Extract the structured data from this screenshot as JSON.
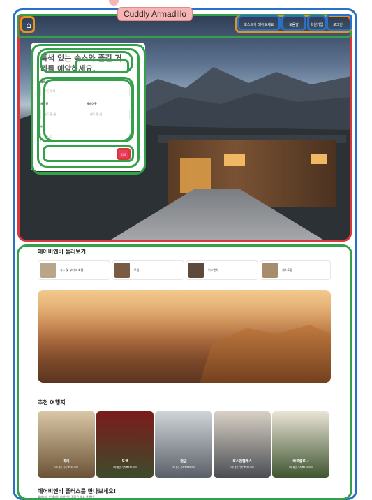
{
  "overlay": {
    "name_tag": "Cuddly Armadillo"
  },
  "nav": {
    "logo_icon": "airbnb-logo-icon",
    "host_label": "호스트가 되어보세요",
    "help_label": "도움말",
    "signup_label": "회원가입",
    "login_label": "로그인"
  },
  "search_card": {
    "title": "특색 있는 숙소와 즐길 거리를 예약하세요.",
    "location_label": "목적지",
    "location_placeholder": "모든 위치",
    "checkin_label": "체크인",
    "checkin_placeholder": "연도-월-일",
    "checkout_label": "체크아웃",
    "checkout_placeholder": "연도-월-일",
    "guests_label": "인원",
    "guests_placeholder": "게스트",
    "search_button": "검색"
  },
  "explore": {
    "title": "에어비앤비 둘러보기",
    "categories": [
      {
        "label": "숙소 및 부티크 호텔",
        "color": "#b8a58a"
      },
      {
        "label": "트립",
        "color": "#7a5c45"
      },
      {
        "label": "어드벤처",
        "color": "#5d4a3c"
      },
      {
        "label": "레스토랑",
        "color": "#a88d6c"
      }
    ]
  },
  "recommended": {
    "title": "추천 여행지",
    "destinations": [
      {
        "name": "파리",
        "sub": "1박 평균 가격 ₩120,000",
        "color_top": "#d9c7a6",
        "color_bottom": "#6b5236"
      },
      {
        "name": "도쿄",
        "sub": "1박 평균 가격 ₩150,000",
        "color_top": "#7b1c1c",
        "color_bottom": "#3d4b2c"
      },
      {
        "name": "런던",
        "sub": "1박 평균 가격 ₩180,000",
        "color_top": "#cfd4d8",
        "color_bottom": "#5b6068"
      },
      {
        "name": "로스앤젤레스",
        "sub": "1박 평균 가격 ₩160,000",
        "color_top": "#d8d0c5",
        "color_bottom": "#4a4e53"
      },
      {
        "name": "바르셀로나",
        "sub": "1박 평균 가격 ₩110,000",
        "color_top": "#e9e4d6",
        "color_bottom": "#3f5530"
      }
    ]
  },
  "plus": {
    "title": "에어비앤비 플러스를 만나보세요!",
    "subtitle": "퀄리티와 인테리어 디자인이 검증된 숙소 셀렉션"
  },
  "colors": {
    "accent": "#ea3c5c",
    "box_blue": "#2a70c7",
    "box_red": "#d9373b",
    "box_green": "#34a04a",
    "box_orange": "#e3951f"
  }
}
